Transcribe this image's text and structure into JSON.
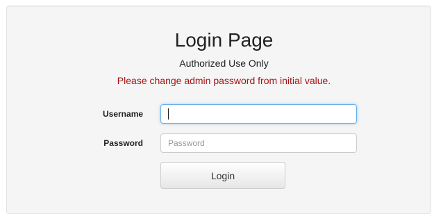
{
  "header": {
    "title": "Login Page",
    "subtitle": "Authorized Use Only",
    "warning": "Please change admin password from initial value."
  },
  "form": {
    "username": {
      "label": "Username",
      "value": "",
      "placeholder": ""
    },
    "password": {
      "label": "Password",
      "value": "",
      "placeholder": "Password"
    },
    "submit_label": "Login"
  },
  "colors": {
    "warning": "#a51313",
    "focus_border": "#66afe9",
    "panel_background": "#f5f5f5"
  }
}
